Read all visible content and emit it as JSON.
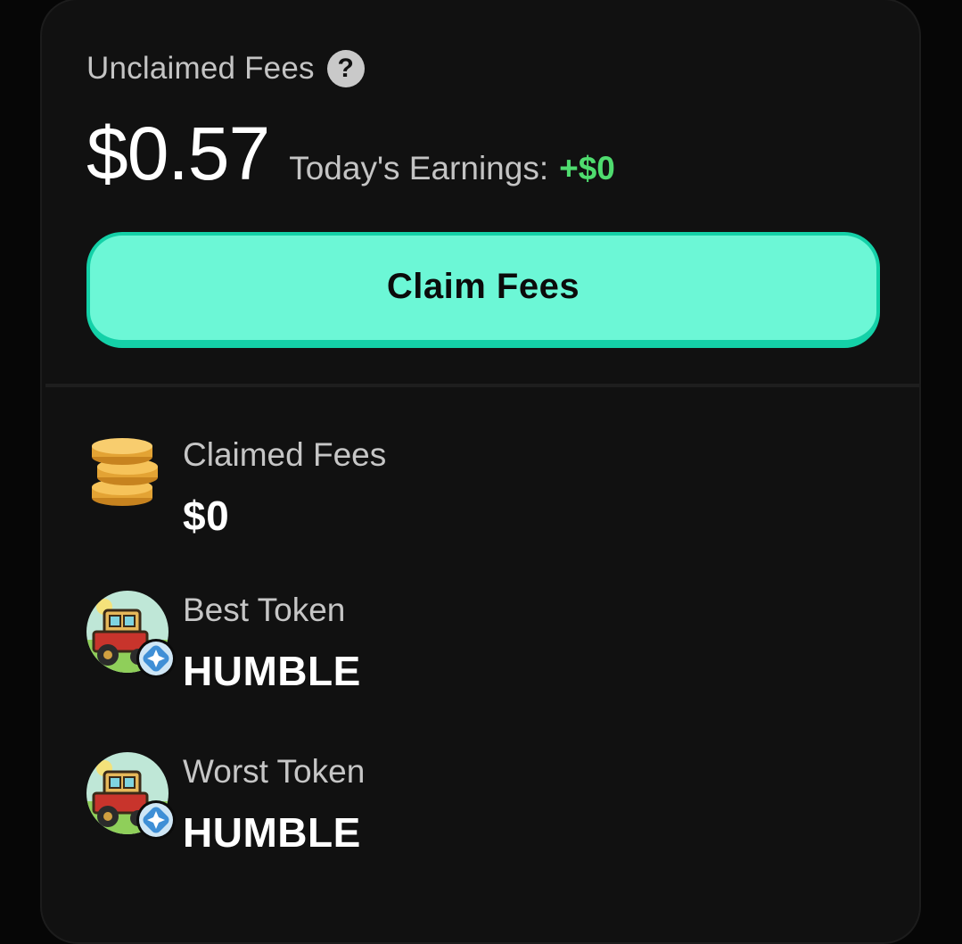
{
  "unclaimed": {
    "label": "Unclaimed Fees",
    "help_icon": "question-circle-icon",
    "amount": "$0.57",
    "today_label": "Today's Earnings:",
    "today_value": "+$0"
  },
  "claim_button": {
    "label": "Claim Fees"
  },
  "stats": {
    "claimed": {
      "icon": "coins-icon",
      "label": "Claimed Fees",
      "value": "$0"
    },
    "best": {
      "icon": "token-avatar",
      "label": "Best Token",
      "value": "HUMBLE"
    },
    "worst": {
      "icon": "token-avatar",
      "label": "Worst Token",
      "value": "HUMBLE"
    }
  },
  "colors": {
    "accent": "#6cf7d6",
    "accent_border": "#14d1a8",
    "positive": "#4fdc6f",
    "card_bg": "#111111"
  }
}
